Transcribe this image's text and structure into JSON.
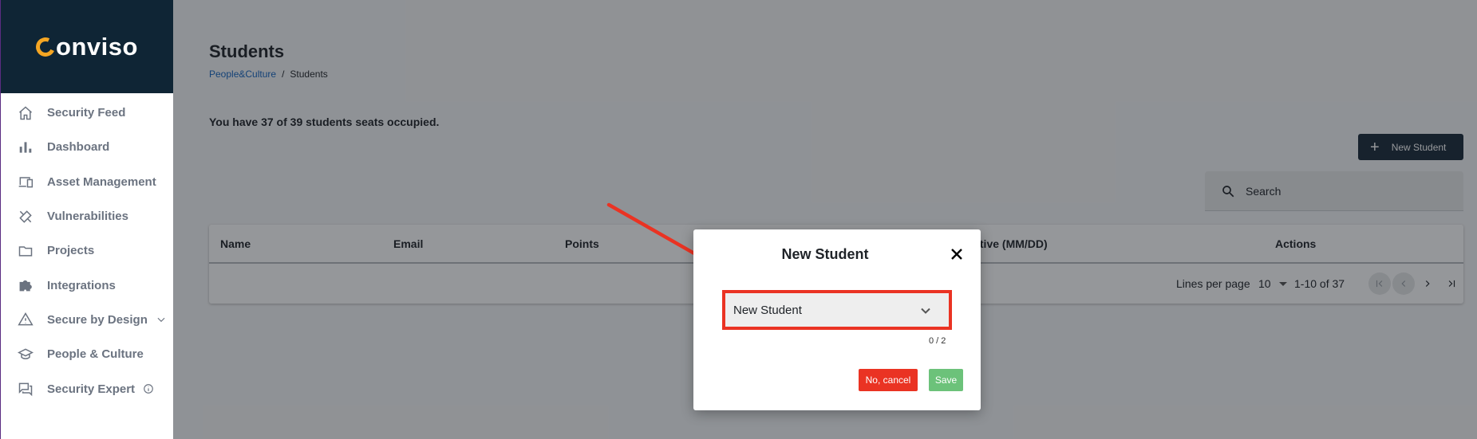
{
  "app": {
    "logo_text": "onviso",
    "logo_full": "Conviso"
  },
  "sidebar": {
    "items": [
      {
        "label": "Security Feed",
        "icon": "home-icon"
      },
      {
        "label": "Dashboard",
        "icon": "bar-chart-icon"
      },
      {
        "label": "Asset Management",
        "icon": "devices-icon"
      },
      {
        "label": "Vulnerabilities",
        "icon": "bandage-icon"
      },
      {
        "label": "Projects",
        "icon": "folder-icon"
      },
      {
        "label": "Integrations",
        "icon": "puzzle-icon"
      },
      {
        "label": "Secure by Design",
        "icon": "warning-icon",
        "extra": "chevron-down-icon"
      },
      {
        "label": "People & Culture",
        "icon": "graduation-cap-icon"
      },
      {
        "label": "Security Expert",
        "icon": "chat-icon",
        "extra": "info-icon"
      }
    ]
  },
  "header": {
    "title": "Students",
    "breadcrumb": {
      "parent": "People&Culture",
      "separator": "/",
      "current": "Students"
    }
  },
  "seats_text": "You have 37 of 39 students seats occupied.",
  "new_student_button": "New Student",
  "search": {
    "placeholder": "Search"
  },
  "table": {
    "columns": [
      "Name",
      "Email",
      "Points",
      "Active (MM/DD)",
      "Actions"
    ],
    "footer": {
      "lines_per_page_label": "Lines per page",
      "lines_per_page_value": "10",
      "range": "1-10 of 37"
    }
  },
  "modal": {
    "title": "New Student",
    "select_value": "New Student",
    "counter": "0 / 2",
    "cancel_label": "No, cancel",
    "save_label": "Save"
  },
  "colors": {
    "sidebar_header": "#0f2535",
    "logo_accent": "#f5a623",
    "primary_button": "#1b2a3a",
    "link": "#1565c0",
    "cancel": "#ea3323",
    "save": "#6cc27a",
    "highlight": "#ea3323"
  }
}
